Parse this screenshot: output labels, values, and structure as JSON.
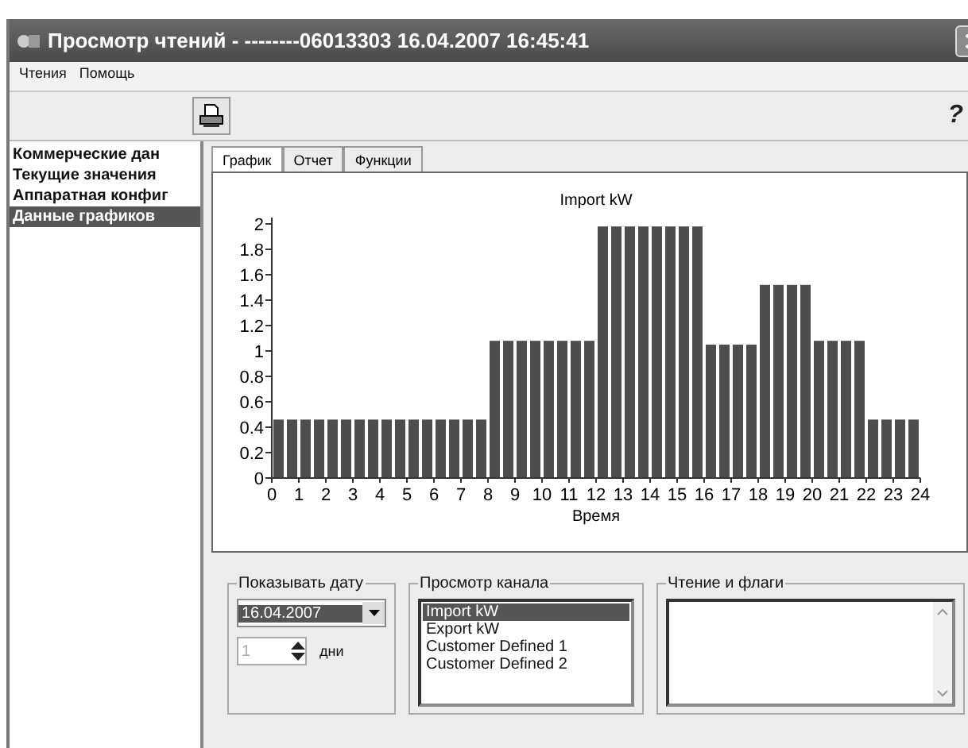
{
  "window": {
    "title": "Просмотр чтений - --------06013303 16.04.2007 16:45:41"
  },
  "menu": [
    "Чтения",
    "Помощь"
  ],
  "toolbar": {
    "help": "?"
  },
  "sidebar": {
    "items": [
      {
        "label": "Коммерческие дан",
        "selected": false
      },
      {
        "label": "Текущие значения",
        "selected": false
      },
      {
        "label": "Аппаратная конфиг",
        "selected": false
      },
      {
        "label": "Данные графиков",
        "selected": true
      }
    ]
  },
  "tabs": [
    {
      "label": "График",
      "selected": true
    },
    {
      "label": "Отчет",
      "selected": false
    },
    {
      "label": "Функции",
      "selected": false
    }
  ],
  "chart": {
    "chart_data": {
      "type": "bar",
      "title": "Import kW",
      "xlabel": "Время",
      "x": [
        0.25,
        0.75,
        1.25,
        1.75,
        2.25,
        2.75,
        3.25,
        3.75,
        4.25,
        4.75,
        5.25,
        5.75,
        6.25,
        6.75,
        7.25,
        7.75,
        8.25,
        8.75,
        9.25,
        9.75,
        10.25,
        10.75,
        11.25,
        11.75,
        12.25,
        12.75,
        13.25,
        13.75,
        14.25,
        14.75,
        15.25,
        15.75,
        16.25,
        16.75,
        17.25,
        17.75,
        18.25,
        18.75,
        19.25,
        19.75,
        20.25,
        20.75,
        21.25,
        21.75,
        22.25,
        22.75,
        23.25,
        23.75
      ],
      "values": [
        0.46,
        0.46,
        0.46,
        0.46,
        0.46,
        0.46,
        0.46,
        0.46,
        0.46,
        0.46,
        0.46,
        0.46,
        0.46,
        0.46,
        0.46,
        0.46,
        1.08,
        1.08,
        1.08,
        1.08,
        1.08,
        1.08,
        1.08,
        1.08,
        1.98,
        1.98,
        1.98,
        1.98,
        1.98,
        1.98,
        1.98,
        1.98,
        1.05,
        1.05,
        1.05,
        1.05,
        1.52,
        1.52,
        1.52,
        1.52,
        1.08,
        1.08,
        1.08,
        1.08,
        0.46,
        0.46,
        0.46,
        0.46
      ],
      "xlim": [
        0,
        24
      ],
      "ylim": [
        0,
        2
      ],
      "xticks": [
        0,
        1,
        2,
        3,
        4,
        5,
        6,
        7,
        8,
        9,
        10,
        11,
        12,
        13,
        14,
        15,
        16,
        17,
        18,
        19,
        20,
        21,
        22,
        23,
        24
      ],
      "yticks": [
        0,
        {
          "value": 0.2,
          "label": "0.2"
        },
        {
          "value": 0.4,
          "label": "0.4"
        },
        {
          "value": 0.6,
          "label": "0.6"
        },
        {
          "value": 0.8,
          "label": "0.8"
        },
        1,
        {
          "value": 1.2,
          "label": "1.2"
        },
        {
          "value": 1.4,
          "label": "1.4"
        },
        {
          "value": 1.6,
          "label": "1.6"
        },
        {
          "value": 1.8,
          "label": "1.8"
        },
        2
      ]
    }
  },
  "date_group": {
    "title": "Показывать дату",
    "date": "16.04.2007",
    "days": "1",
    "days_label": "дни"
  },
  "channel_group": {
    "title": "Просмотр канала",
    "items": [
      {
        "label": "Import kW",
        "selected": true
      },
      {
        "label": "Export kW",
        "selected": false
      },
      {
        "label": "Customer Defined 1",
        "selected": false
      },
      {
        "label": "Customer Defined 2",
        "selected": false
      }
    ]
  },
  "flags_group": {
    "title": "Чтение и флаги"
  }
}
